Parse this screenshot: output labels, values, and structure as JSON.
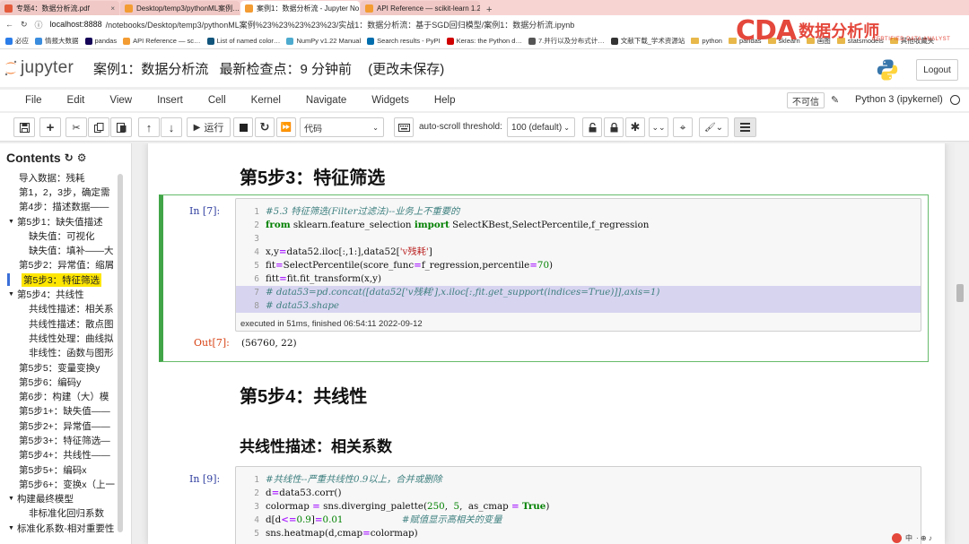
{
  "browser": {
    "tabs": [
      {
        "label": "专题4：数据分析流.pdf",
        "color": "#e45b3c",
        "active": false
      },
      {
        "label": "Desktop/temp3/pythonML案例…",
        "color": "#f39c33",
        "active": false
      },
      {
        "label": "案例1：数据分析流 - Jupyter No…",
        "color": "#f39c33",
        "active": true
      },
      {
        "label": "API Reference — scikit-learn 1.2…",
        "color": "#f39c33",
        "active": false
      }
    ],
    "url_host": "localhost:8888",
    "url_path": "/notebooks/Desktop/temp3/pythonML案例%23%23%23%23%23/实战1：数据分析流：基于SGD回归模型/案例1：数据分析流.ipynb",
    "bookmarks": [
      {
        "label": "必应",
        "color": "#2b7de9"
      },
      {
        "label": "情报大数据",
        "color": "#3a8dde"
      },
      {
        "label": "pandas",
        "color": "#150458"
      },
      {
        "label": "API Reference — sc…",
        "color": "#f39c33"
      },
      {
        "label": "List of named color…",
        "color": "#11557c"
      },
      {
        "label": "NumPy v1.22 Manual",
        "color": "#4dabcf"
      },
      {
        "label": "Search results - PyPI",
        "color": "#006dad"
      },
      {
        "label": "Keras: the Python d…",
        "color": "#d00000"
      },
      {
        "label": "7.并行以及分布式计…",
        "color": "#555555"
      },
      {
        "label": "文献下载_学术资源站",
        "color": "#333333"
      },
      {
        "label": "python",
        "color": "folder"
      },
      {
        "label": "pandas",
        "color": "folder"
      },
      {
        "label": "sklearn",
        "color": "folder"
      },
      {
        "label": "画图",
        "color": "folder"
      },
      {
        "label": "statsmodels",
        "color": "folder"
      },
      {
        "label": "其他收藏夹",
        "color": "folder"
      }
    ]
  },
  "watermark": {
    "mark": "CDA",
    "name": "数据分析师",
    "sub": "CERTIFIED DATA ANALYST"
  },
  "header": {
    "logo_word": "jupyter",
    "notebook_name": "案例1：数据分析流",
    "checkpoint": "最新检查点：9 分钟前",
    "unsaved": "(更改未保存)",
    "logout": "Logout"
  },
  "menubar": {
    "items": [
      "File",
      "Edit",
      "View",
      "Insert",
      "Cell",
      "Kernel",
      "Navigate",
      "Widgets",
      "Help"
    ],
    "trust": "不可信",
    "kernel": "Python 3 (ipykernel)"
  },
  "toolbar": {
    "run_label": "运行",
    "cell_type": "代码",
    "autoscroll_label": "auto-scroll threshold:",
    "autoscroll_value": "100 (default)"
  },
  "toc": {
    "title": "Contents",
    "items": [
      {
        "label": "导入数据：残耗",
        "level": "l1",
        "caret": ""
      },
      {
        "label": "第1，2，3步，确定需",
        "level": "l1",
        "caret": ""
      },
      {
        "label": "第4步：描述数据——",
        "level": "l1",
        "caret": ""
      },
      {
        "label": "第5步1：缺失值描述",
        "level": "l1c",
        "caret": "▼"
      },
      {
        "label": "缺失值：可视化",
        "level": "l2",
        "caret": ""
      },
      {
        "label": "缺失值：填补——大",
        "level": "l2",
        "caret": ""
      },
      {
        "label": "第5步2：异常值：缩屑",
        "level": "l1",
        "caret": ""
      },
      {
        "label": "第5步3：特征筛选",
        "level": "l1",
        "caret": "",
        "active": true
      },
      {
        "label": "第5步4：共线性",
        "level": "l1c",
        "caret": "▼"
      },
      {
        "label": "共线性描述：相关系",
        "level": "l2",
        "caret": ""
      },
      {
        "label": "共线性描述：散点图",
        "level": "l2",
        "caret": ""
      },
      {
        "label": "共线性处理：曲线拟",
        "level": "l2",
        "caret": ""
      },
      {
        "label": "非线性：函数与图形",
        "level": "l2",
        "caret": ""
      },
      {
        "label": "第5步5：变量变换y",
        "level": "l1",
        "caret": ""
      },
      {
        "label": "第5步6：编码y",
        "level": "l1",
        "caret": ""
      },
      {
        "label": "第6步：构建（大）模",
        "level": "l1",
        "caret": ""
      },
      {
        "label": "第5步1+：缺失值——",
        "level": "l1",
        "caret": ""
      },
      {
        "label": "第5步2+：异常值——",
        "level": "l1",
        "caret": ""
      },
      {
        "label": "第5步3+：特征筛选—",
        "level": "l1",
        "caret": ""
      },
      {
        "label": "第5步4+：共线性——",
        "level": "l1",
        "caret": ""
      },
      {
        "label": "第5步5+：编码x",
        "level": "l1",
        "caret": ""
      },
      {
        "label": "第5步6+：变换x（上一",
        "level": "l1",
        "caret": ""
      },
      {
        "label": "构建最终模型",
        "level": "l1c",
        "caret": "▼"
      },
      {
        "label": "非标准化回归系数",
        "level": "l2",
        "caret": ""
      },
      {
        "label": "标准化系数-相对重要性",
        "level": "l1c",
        "caret": "▼"
      }
    ]
  },
  "notebook": {
    "heading1": "第5步3：特征筛选",
    "cell7": {
      "prompt_in": "In  [7]:",
      "lines": [
        {
          "n": "1",
          "html_key": "l1"
        },
        {
          "n": "2",
          "html_key": "l2"
        },
        {
          "n": "3",
          "html_key": "l3"
        },
        {
          "n": "4",
          "html_key": "l4"
        },
        {
          "n": "5",
          "html_key": "l5"
        },
        {
          "n": "6",
          "html_key": "l6"
        },
        {
          "n": "7",
          "html_key": "l7"
        },
        {
          "n": "8",
          "html_key": "l8"
        }
      ],
      "code": {
        "l1": "#5.3 特征筛选(Filter过滤法)--业务上不重要的",
        "l2a": "from",
        "l2b": " sklearn.feature_selection ",
        "l2c": "import",
        "l2d": " SelectKBest,SelectPercentile,f_regression",
        "l3": "",
        "l4a": "x,y",
        "l4b": "=",
        "l4c": "data52.iloc[:,1:],data52[",
        "l4d": "'v残耗'",
        "l4e": "]",
        "l5a": "fit",
        "l5b": "=",
        "l5c": "SelectPercentile(score_func",
        "l5d": "=",
        "l5e": "f_regression,percentile",
        "l5f": "=",
        "l5g": "70",
        "l5h": ")",
        "l6a": "fitt",
        "l6b": "=",
        "l6c": "fit.fit_transform(x,y)",
        "l7": "# data53=pd.concat([data52['v残耗'],x.iloc[:,fit.get_support(indices=True)]],axis=1)",
        "l8": "# data53.shape"
      },
      "exec_info": "executed in 51ms, finished 06:54:11 2022-09-12",
      "prompt_out": "Out[7]:",
      "output": "(56760, 22)"
    },
    "heading2": "第5步4：共线性",
    "heading3": "共线性描述：相关系数",
    "cell9": {
      "prompt_in": "In  [9]:",
      "code": {
        "l1": "#共线性--严重共线性0.9以上，合并或删除",
        "l2a": "d",
        "l2b": "=",
        "l2c": "data53.corr()",
        "l3a": "colormap ",
        "l3b": "=",
        "l3c": " sns.diverging_palette(",
        "l3d": "250",
        "l3e": ",  ",
        "l3f": "5",
        "l3g": ",  as_cmap ",
        "l3h": "=",
        "l3i": " ",
        "l3j": "True",
        "l3k": ")",
        "l4a": "d[d",
        "l4b": "<=",
        "l4c": "0.9",
        "l4d": "]",
        "l4e": "=",
        "l4f": "0.01",
        "l4g": "                    #赋值显示高相关的变量",
        "l5a": "sns.heatmap(d,cmap",
        "l5b": "=",
        "l5c": "colormap)"
      }
    }
  },
  "system": {
    "ime": "中",
    "extra": "· ⊕ ♪"
  }
}
